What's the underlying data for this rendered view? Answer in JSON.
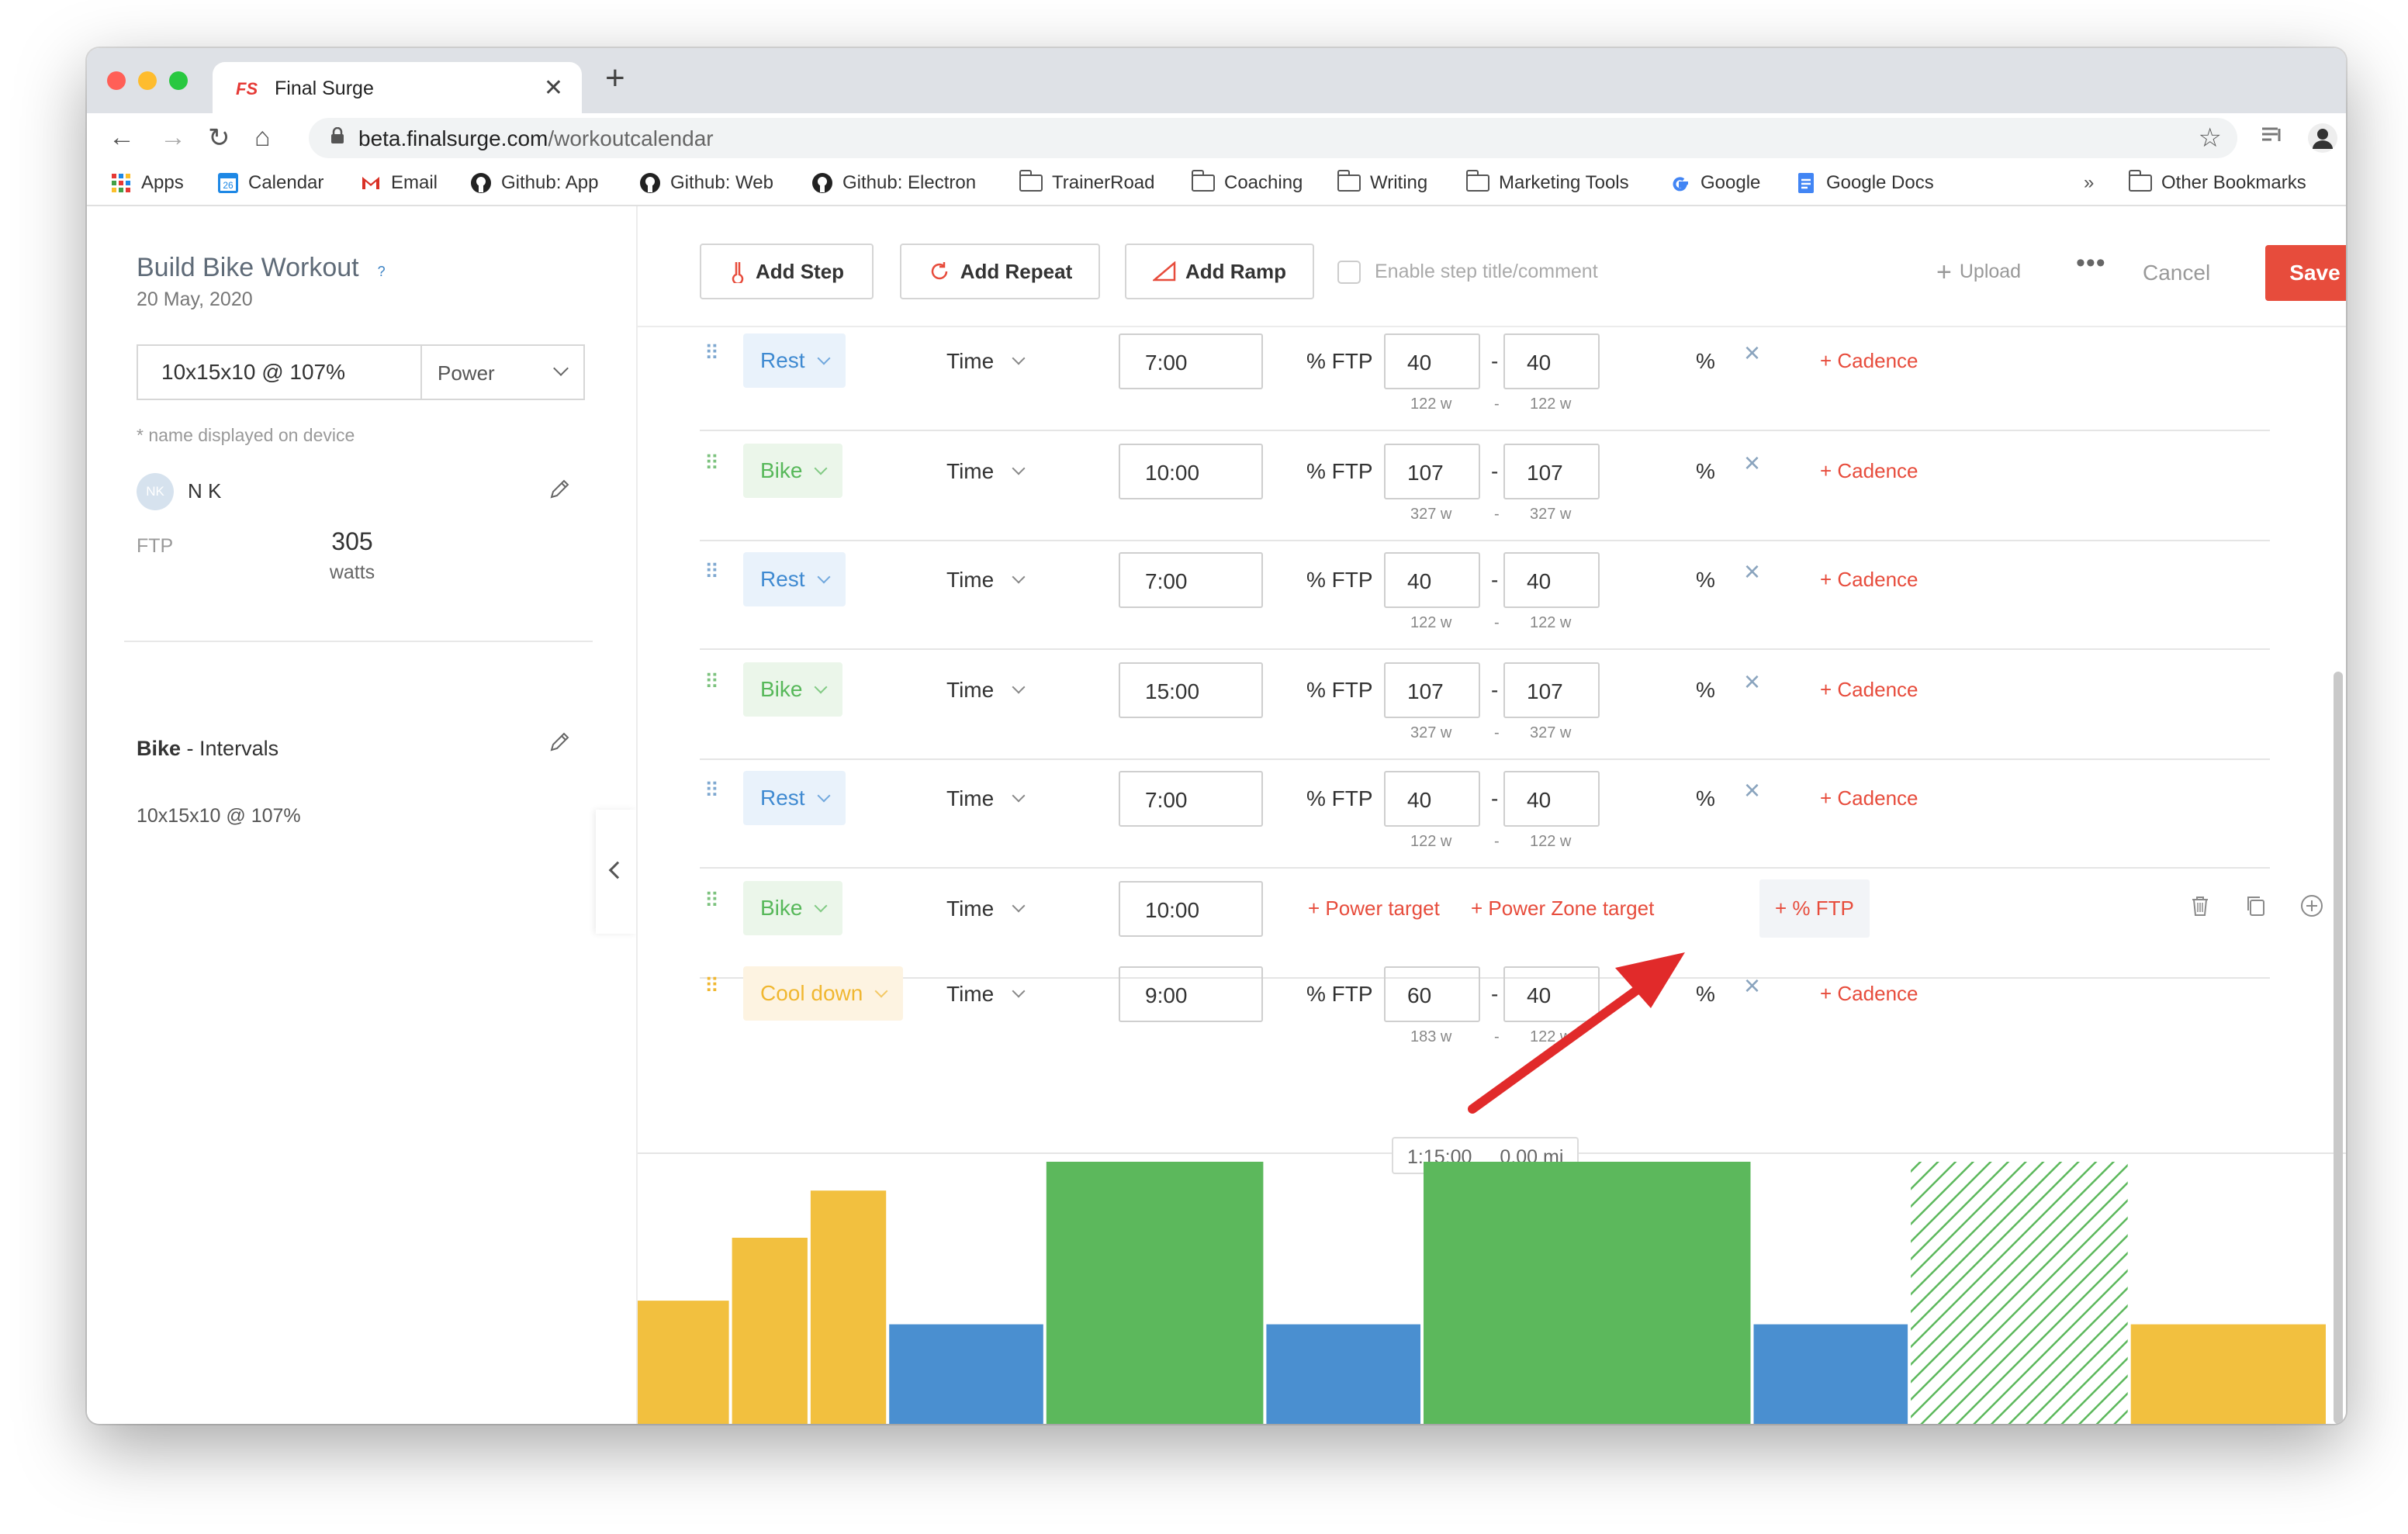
{
  "browser": {
    "tab_title": "Final Surge",
    "tab_favicon": "FS",
    "url_host": "beta.finalsurge.com",
    "url_path": "/workoutcalendar",
    "bookmarks": [
      {
        "label": "Apps",
        "icon": "apps-grid-icon"
      },
      {
        "label": "Calendar",
        "icon": "calendar-icon"
      },
      {
        "label": "Email",
        "icon": "gmail-icon"
      },
      {
        "label": "Github: App",
        "icon": "github-icon"
      },
      {
        "label": "Github: Web",
        "icon": "github-icon"
      },
      {
        "label": "Github: Electron",
        "icon": "github-icon"
      },
      {
        "label": "TrainerRoad",
        "icon": "folder-icon"
      },
      {
        "label": "Coaching",
        "icon": "folder-icon"
      },
      {
        "label": "Writing",
        "icon": "folder-icon"
      },
      {
        "label": "Marketing Tools",
        "icon": "folder-icon"
      },
      {
        "label": "Google",
        "icon": "google-icon"
      },
      {
        "label": "Google Docs",
        "icon": "google-docs-icon"
      }
    ],
    "bookmarks_overflow": "»",
    "other_bookmarks": "Other Bookmarks",
    "calendar_day": "26"
  },
  "workout": {
    "title": "Build Bike Workout",
    "help": "?",
    "date": "20 May, 2020",
    "name": "10x15x10 @ 107%",
    "target_type": "Power",
    "name_note": "* name displayed on device",
    "user_initials": "NK",
    "user_name": "N K",
    "ftp_label": "FTP",
    "ftp_value": "305",
    "ftp_unit": "watts",
    "sport": "Bike",
    "sport_sub": " - Intervals",
    "description": "10x15x10 @ 107%"
  },
  "toolbar": {
    "add_step": "Add Step",
    "add_repeat": "Add Repeat",
    "add_ramp": "Add Ramp",
    "enable_title": "Enable step title/comment",
    "upload": "Upload",
    "more": "•••",
    "cancel": "Cancel",
    "save": "Save"
  },
  "labels": {
    "time": "Time",
    "pct_ftp": "% FTP",
    "dash": "-",
    "pct": "%",
    "cadence": "+ Cadence",
    "power_target": "+ Power target",
    "power_zone_target": "+ Power Zone target",
    "pct_ftp_target": "+ % FTP",
    "remove": "×"
  },
  "steps": [
    {
      "type": "Rest",
      "duration": "7:00",
      "low": "40",
      "high": "40",
      "low_w": "122 w",
      "high_w": "122 w"
    },
    {
      "type": "Bike",
      "duration": "10:00",
      "low": "107",
      "high": "107",
      "low_w": "327 w",
      "high_w": "327 w"
    },
    {
      "type": "Rest",
      "duration": "7:00",
      "low": "40",
      "high": "40",
      "low_w": "122 w",
      "high_w": "122 w"
    },
    {
      "type": "Bike",
      "duration": "15:00",
      "low": "107",
      "high": "107",
      "low_w": "327 w",
      "high_w": "327 w"
    },
    {
      "type": "Rest",
      "duration": "7:00",
      "low": "40",
      "high": "40",
      "low_w": "122 w",
      "high_w": "122 w"
    },
    {
      "type": "Bike",
      "duration": "10:00"
    },
    {
      "type": "Cool down",
      "duration": "9:00",
      "low": "60",
      "high": "40",
      "low_w": "183 w",
      "high_w": "122 w"
    }
  ],
  "totals": {
    "time": "1:15:00",
    "distance": "0.00 mi"
  },
  "colors": {
    "rest": "#4a8fd0",
    "bike": "#5cb85c",
    "warmup": "#f2c03f",
    "accent": "#e74c3c"
  },
  "chart_data": {
    "type": "bar",
    "title": "",
    "xlabel": "",
    "ylabel": "",
    "blocks": [
      {
        "kind": "warmup",
        "duration_min": 3,
        "height": 0.47
      },
      {
        "kind": "warmup",
        "duration_min": 2.5,
        "height": 0.71
      },
      {
        "kind": "warmup",
        "duration_min": 2.5,
        "height": 0.89
      },
      {
        "kind": "rest",
        "duration_min": 5,
        "height": 0.38
      },
      {
        "kind": "bike",
        "duration_min": 7,
        "height": 1.0
      },
      {
        "kind": "rest",
        "duration_min": 5,
        "height": 0.38
      },
      {
        "kind": "bike",
        "duration_min": 10.5,
        "height": 1.0
      },
      {
        "kind": "rest",
        "duration_min": 5,
        "height": 0.38
      },
      {
        "kind": "bike-hatched",
        "duration_min": 7,
        "height": 1.0
      },
      {
        "kind": "warmup",
        "duration_min": 6.3,
        "height": 0.38
      }
    ]
  }
}
